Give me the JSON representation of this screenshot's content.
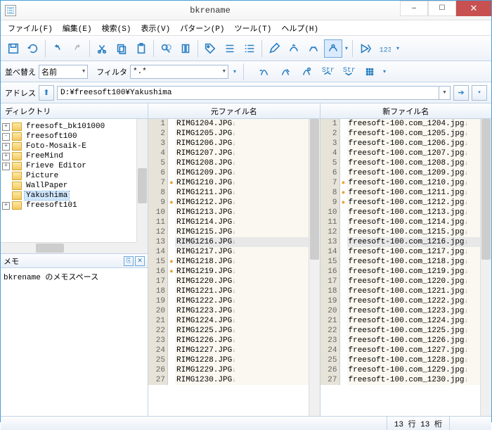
{
  "window": {
    "title": "bkrename"
  },
  "menu": {
    "file": "ファイル(F)",
    "edit": "編集(E)",
    "search": "検索(S)",
    "view": "表示(V)",
    "pattern": "パターン(P)",
    "tool": "ツール(T)",
    "help": "ヘルプ(H)"
  },
  "row2": {
    "sort_label": "並べ替え",
    "sort_value": "名前",
    "filter_label": "フィルタ",
    "filter_value": "*.*"
  },
  "address": {
    "label": "アドレス",
    "path": "D:¥freesoft100¥Yakushima"
  },
  "dir": {
    "header": "ディレクトリ"
  },
  "tree": {
    "items": [
      {
        "level": 2,
        "exp": "+",
        "label": "freesoft_bk101000"
      },
      {
        "level": 2,
        "exp": "-",
        "label": "freesoft100"
      },
      {
        "level": 3,
        "exp": "+",
        "label": "Foto-Mosaik-E"
      },
      {
        "level": 3,
        "exp": "+",
        "label": "FreeMind"
      },
      {
        "level": 3,
        "exp": "+",
        "label": "Frieve Editor"
      },
      {
        "level": 3,
        "exp": " ",
        "label": "Picture"
      },
      {
        "level": 3,
        "exp": " ",
        "label": "WallPaper"
      },
      {
        "level": 3,
        "exp": " ",
        "label": "Yakushima",
        "selected": true
      },
      {
        "level": 2,
        "exp": "+",
        "label": "freesoft101"
      }
    ]
  },
  "memo": {
    "header": "メモ",
    "text": "bkrename のメモスペース"
  },
  "columns": {
    "original": "元ファイル名",
    "new": "新ファイル名"
  },
  "files": {
    "original": [
      {
        "n": 1,
        "name": "RIMG1204.JPG"
      },
      {
        "n": 2,
        "name": "RIMG1205.JPG"
      },
      {
        "n": 3,
        "name": "RIMG1206.JPG"
      },
      {
        "n": 4,
        "name": "RIMG1207.JPG"
      },
      {
        "n": 5,
        "name": "RIMG1208.JPG"
      },
      {
        "n": 6,
        "name": "RIMG1209.JPG"
      },
      {
        "n": 7,
        "name": "RIMG1210.JPG",
        "mark": true
      },
      {
        "n": 8,
        "name": "RIMG1211.JPG"
      },
      {
        "n": 9,
        "name": "RIMG1212.JPG",
        "mark": true
      },
      {
        "n": 10,
        "name": "RIMG1213.JPG"
      },
      {
        "n": 11,
        "name": "RIMG1214.JPG"
      },
      {
        "n": 12,
        "name": "RIMG1215.JPG"
      },
      {
        "n": 13,
        "name": "RIMG1216.JPG",
        "sel": true
      },
      {
        "n": 14,
        "name": "RIMG1217.JPG"
      },
      {
        "n": 15,
        "name": "RIMG1218.JPG",
        "mark": true
      },
      {
        "n": 16,
        "name": "RIMG1219.JPG",
        "mark": true
      },
      {
        "n": 17,
        "name": "RIMG1220.JPG"
      },
      {
        "n": 18,
        "name": "RIMG1221.JPG"
      },
      {
        "n": 19,
        "name": "RIMG1222.JPG"
      },
      {
        "n": 20,
        "name": "RIMG1223.JPG"
      },
      {
        "n": 21,
        "name": "RIMG1224.JPG"
      },
      {
        "n": 22,
        "name": "RIMG1225.JPG"
      },
      {
        "n": 23,
        "name": "RIMG1226.JPG"
      },
      {
        "n": 24,
        "name": "RIMG1227.JPG"
      },
      {
        "n": 25,
        "name": "RIMG1228.JPG"
      },
      {
        "n": 26,
        "name": "RIMG1229.JPG"
      },
      {
        "n": 27,
        "name": "RIMG1230.JPG"
      }
    ],
    "new": [
      {
        "n": 1,
        "name": "freesoft-100.com_1204.jpg"
      },
      {
        "n": 2,
        "name": "freesoft-100.com_1205.jpg"
      },
      {
        "n": 3,
        "name": "freesoft-100.com_1206.jpg"
      },
      {
        "n": 4,
        "name": "freesoft-100.com_1207.jpg"
      },
      {
        "n": 5,
        "name": "freesoft-100.com_1208.jpg"
      },
      {
        "n": 6,
        "name": "freesoft-100.com_1209.jpg"
      },
      {
        "n": 7,
        "name": "freesoft-100.com_1210.jpg",
        "mark": true
      },
      {
        "n": 8,
        "name": "freesoft-100.com_1211.jpg",
        "mark": true
      },
      {
        "n": 9,
        "name": "freesoft-100.com_1212.jpg",
        "mark": true
      },
      {
        "n": 10,
        "name": "freesoft-100.com_1213.jpg"
      },
      {
        "n": 11,
        "name": "freesoft-100.com_1214.jpg"
      },
      {
        "n": 12,
        "name": "freesoft-100.com_1215.jpg"
      },
      {
        "n": 13,
        "name": "freesoft-100.com_1216.jpg",
        "sel": true
      },
      {
        "n": 14,
        "name": "freesoft-100.com_1217.jpg"
      },
      {
        "n": 15,
        "name": "freesoft-100.com_1218.jpg"
      },
      {
        "n": 16,
        "name": "freesoft-100.com_1219.jpg"
      },
      {
        "n": 17,
        "name": "freesoft-100.com_1220.jpg"
      },
      {
        "n": 18,
        "name": "freesoft-100.com_1221.jpg"
      },
      {
        "n": 19,
        "name": "freesoft-100.com_1222.jpg"
      },
      {
        "n": 20,
        "name": "freesoft-100.com_1223.jpg"
      },
      {
        "n": 21,
        "name": "freesoft-100.com_1224.jpg"
      },
      {
        "n": 22,
        "name": "freesoft-100.com_1225.jpg"
      },
      {
        "n": 23,
        "name": "freesoft-100.com_1226.jpg"
      },
      {
        "n": 24,
        "name": "freesoft-100.com_1227.jpg"
      },
      {
        "n": 25,
        "name": "freesoft-100.com_1228.jpg"
      },
      {
        "n": 26,
        "name": "freesoft-100.com_1229.jpg"
      },
      {
        "n": 27,
        "name": "freesoft-100.com_1230.jpg"
      }
    ]
  },
  "status": {
    "pos": "13 行 13 桁"
  }
}
